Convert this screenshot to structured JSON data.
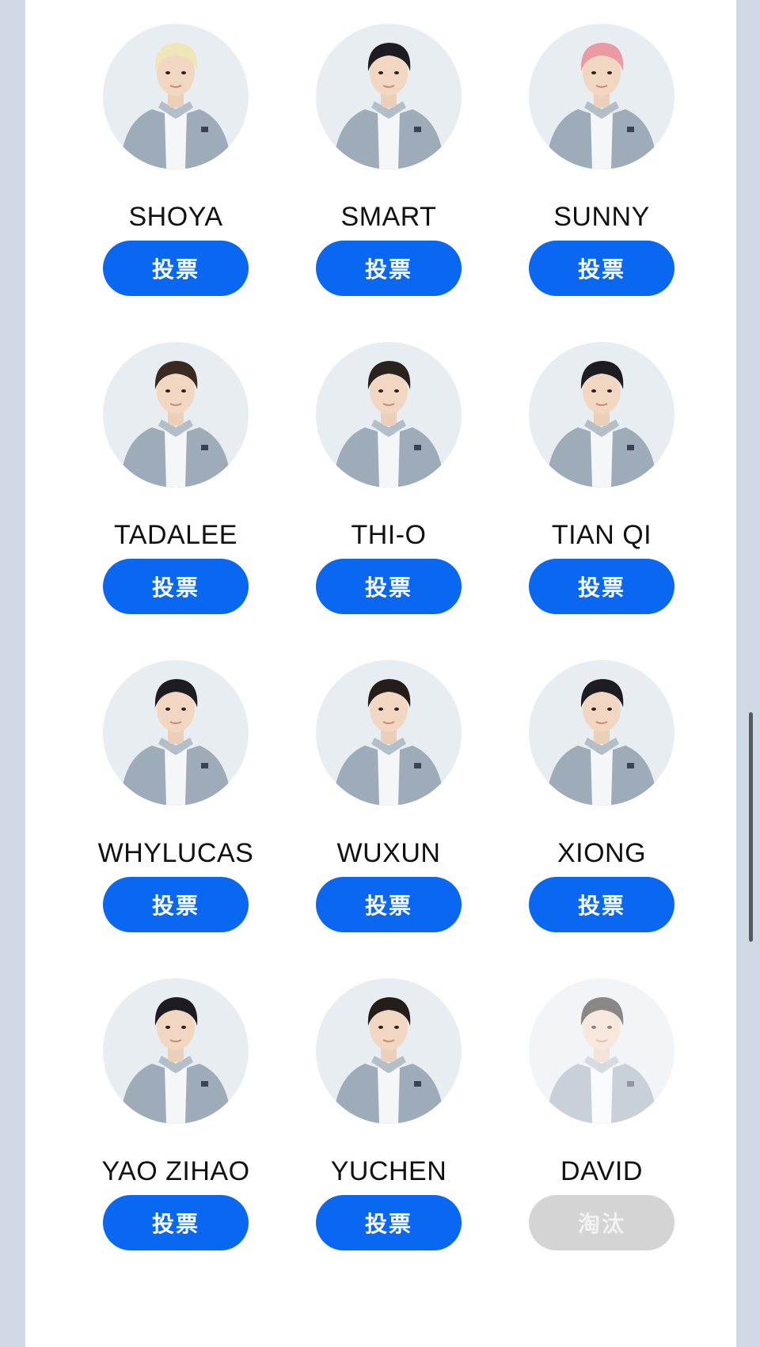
{
  "colors": {
    "accent": "#0a67f2",
    "disabled": "#d4d4d4",
    "page_background": "#cfd9e6",
    "panel_background": "#ffffff"
  },
  "contestants": [
    {
      "name": "SHOYA",
      "button_label": "投票",
      "status": "active",
      "hair": "#eee6b8"
    },
    {
      "name": "SMART",
      "button_label": "投票",
      "status": "active",
      "hair": "#1c1c22"
    },
    {
      "name": "SUNNY",
      "button_label": "投票",
      "status": "active",
      "hair": "#e99aa3"
    },
    {
      "name": "TADALEE",
      "button_label": "投票",
      "status": "active",
      "hair": "#3b2a22"
    },
    {
      "name": "THI-O",
      "button_label": "投票",
      "status": "active",
      "hair": "#2a221d"
    },
    {
      "name": "TIAN QI",
      "button_label": "投票",
      "status": "active",
      "hair": "#1c1c22"
    },
    {
      "name": "WHYLUCAS",
      "button_label": "投票",
      "status": "active",
      "hair": "#1c1c22"
    },
    {
      "name": "WUXUN",
      "button_label": "投票",
      "status": "active",
      "hair": "#241d19"
    },
    {
      "name": "XIONG",
      "button_label": "投票",
      "status": "active",
      "hair": "#1c1c22"
    },
    {
      "name": "YAO ZIHAO",
      "button_label": "投票",
      "status": "active",
      "hair": "#1c1c22"
    },
    {
      "name": "YUCHEN",
      "button_label": "投票",
      "status": "active",
      "hair": "#241d19"
    },
    {
      "name": "DAVID",
      "button_label": "淘汰",
      "status": "eliminated",
      "hair": "#2a2522"
    }
  ]
}
